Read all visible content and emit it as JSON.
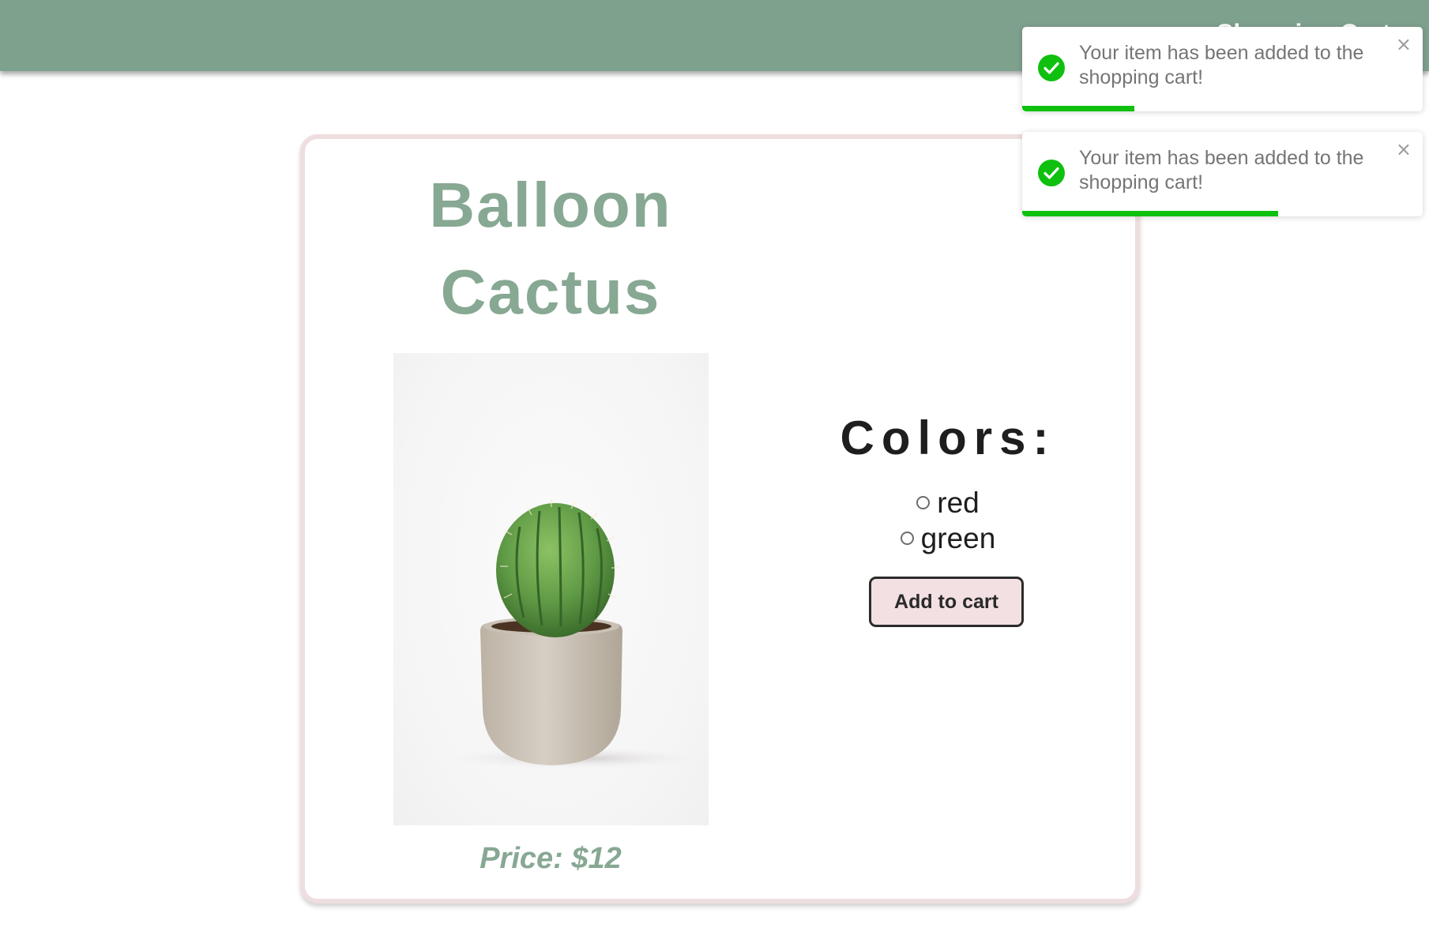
{
  "header": {
    "text": "Shopping Cart"
  },
  "product": {
    "title": "Balloon Cactus",
    "image_alt": "Balloon cactus in a beige ceramic pot",
    "price": "Price: $12"
  },
  "colors": {
    "heading": "Colors:",
    "options": [
      {
        "label": "red",
        "selected": false
      },
      {
        "label": "green",
        "selected": false
      }
    ]
  },
  "actions": {
    "add_to_cart_label": "Add to cart"
  },
  "toasts": [
    {
      "message": "Your item has been added to the shopping cart!",
      "close_symbol": "×",
      "progress": 0.28,
      "icon": "check-circle-icon"
    },
    {
      "message": "Your item has been added to the shopping cart!",
      "close_symbol": "×",
      "progress": 0.64,
      "icon": "check-circle-icon"
    }
  ],
  "colors_theme": {
    "header_green": "#7ea18d",
    "title_green": "#87a893",
    "card_border_pink": "#efdedf",
    "button_pink": "#f3e0e2",
    "toast_success_green": "#0fc00f"
  }
}
